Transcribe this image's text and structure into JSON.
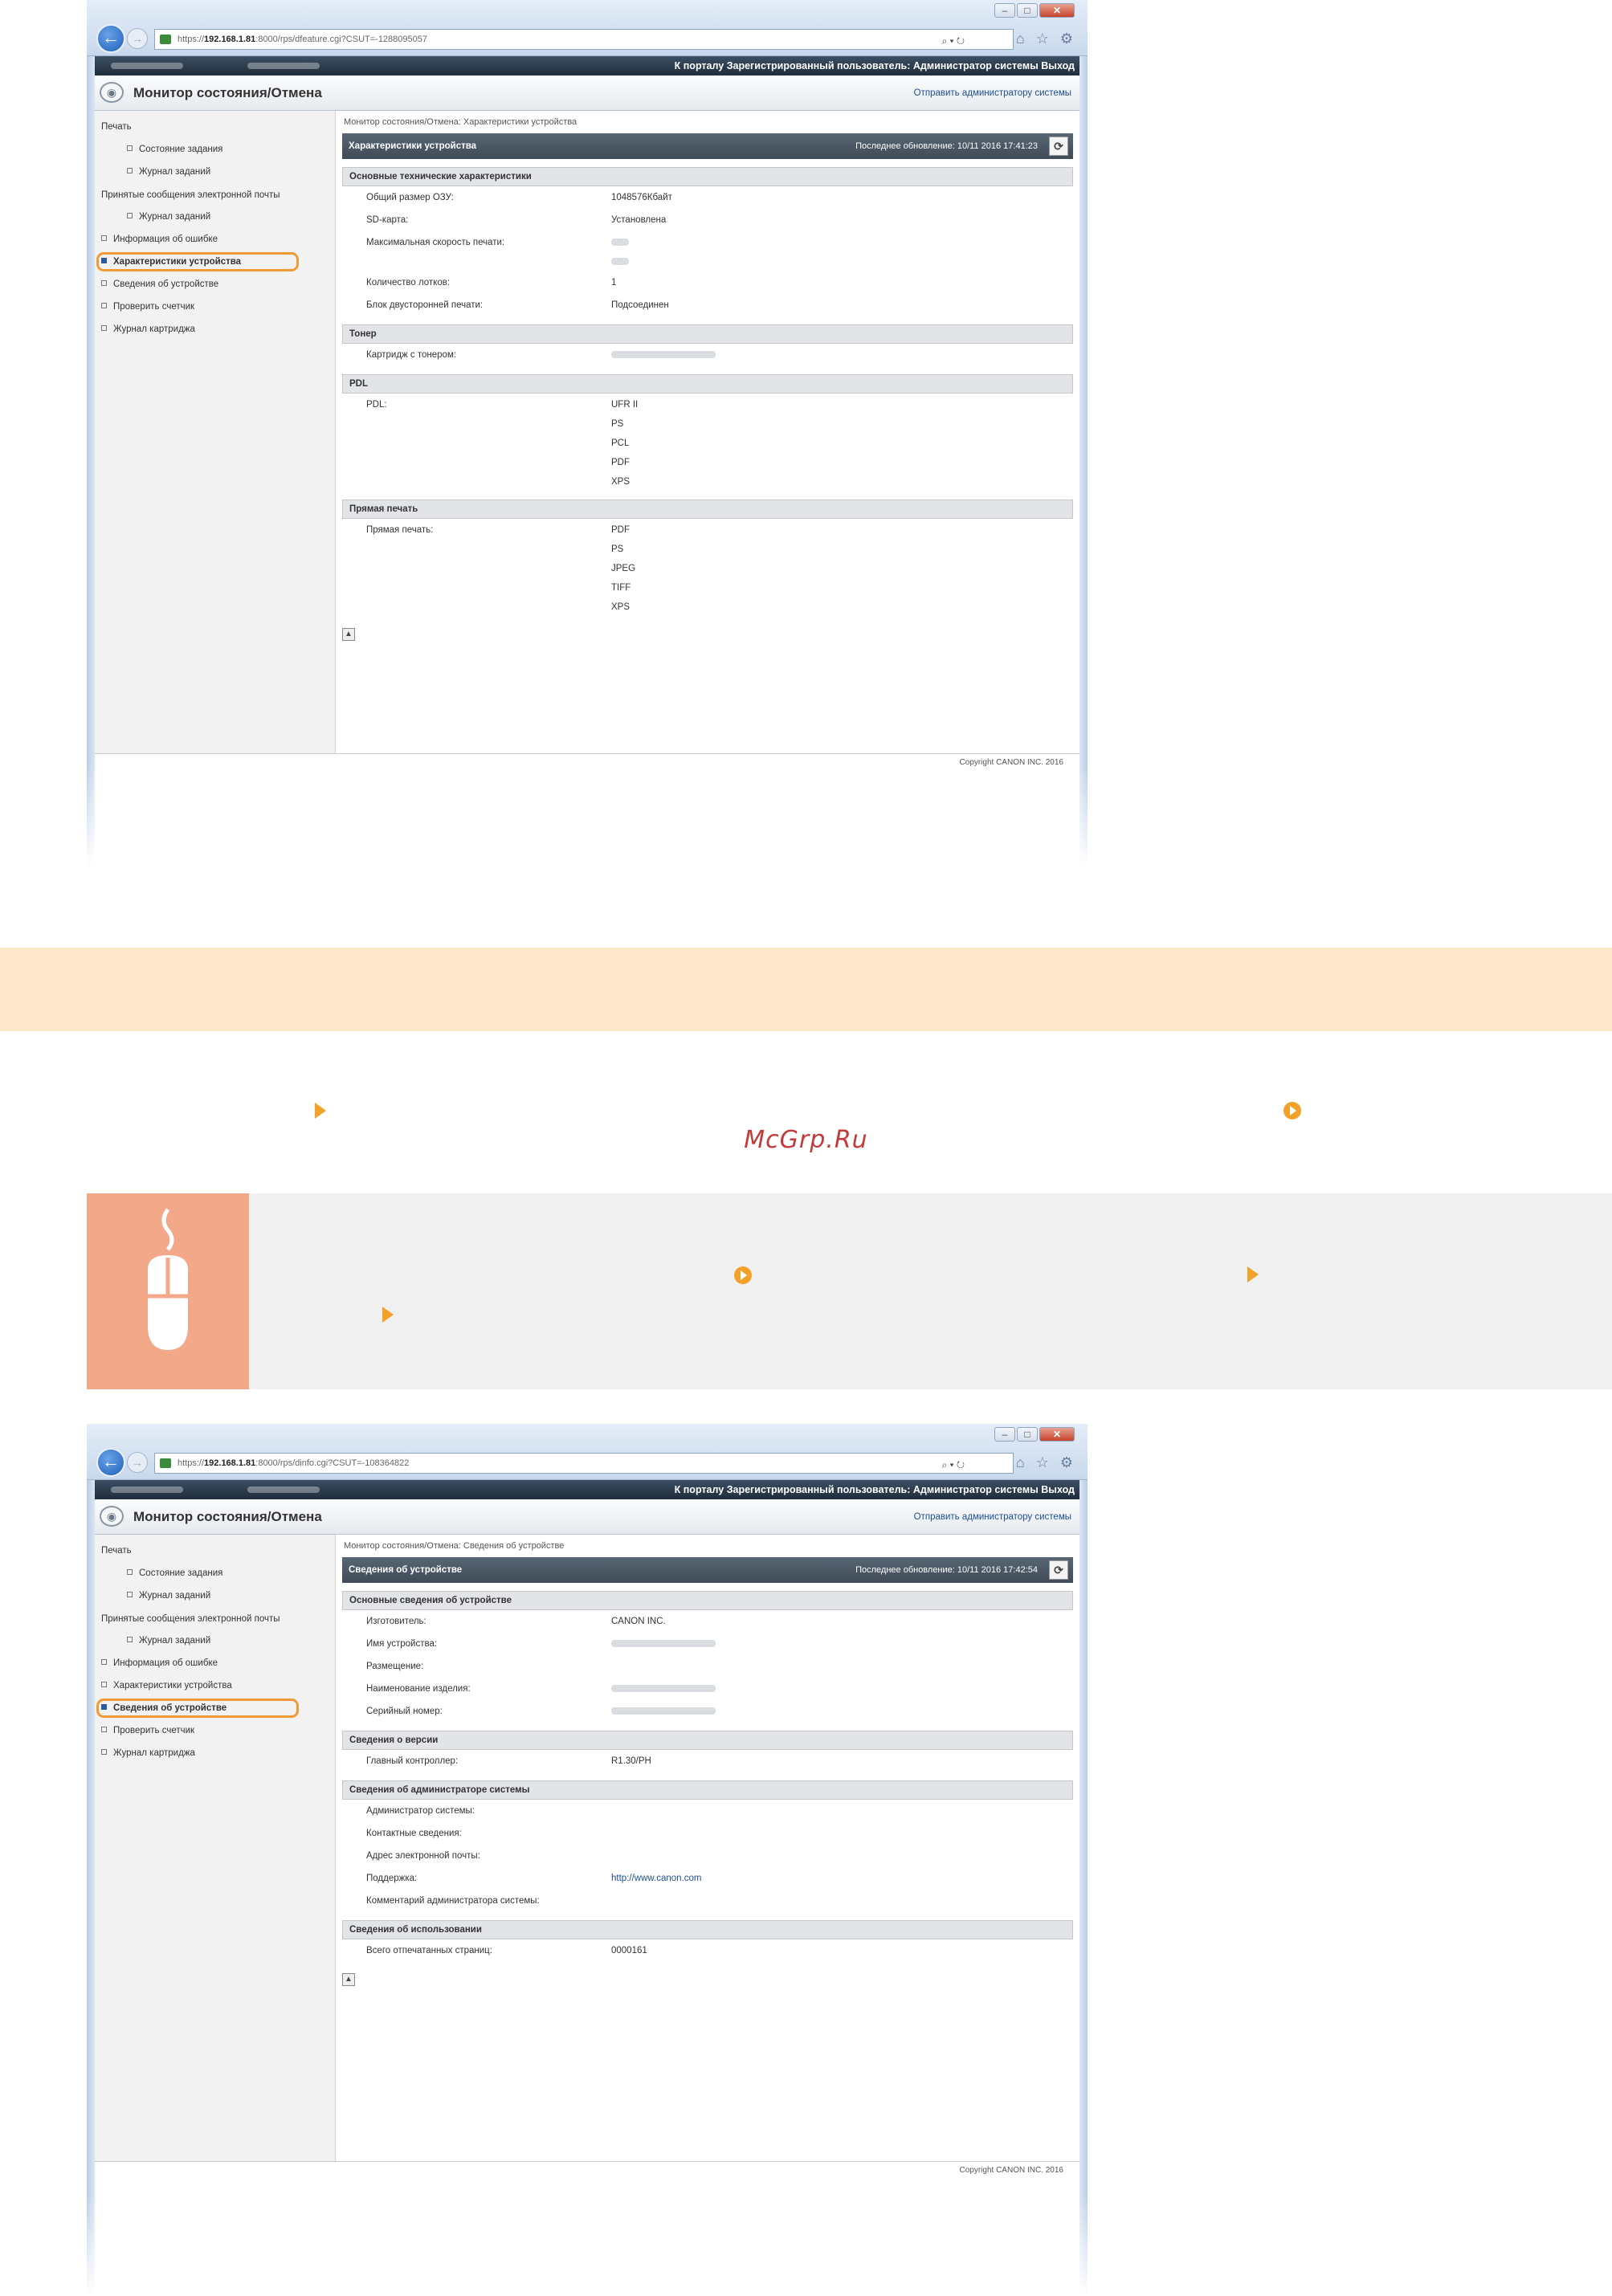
{
  "watermark": "McGrp.Ru",
  "screens": [
    {
      "url_prefix": "https://",
      "url_host": "192.168.1.81",
      "url_path": ":8000/rps/dfeature.cgi?CSUT=-1288095057",
      "addr_tools": "⌕ ▾ ↻",
      "topbar_links": "К порталу   Зарегистрированный пользователь: Администратор системы   Выход",
      "header_title": "Монитор состояния/Отмена",
      "header_link": "Отправить администратору системы",
      "sidebar": [
        {
          "label": "Печать",
          "type": "group"
        },
        {
          "label": "Состояние задания",
          "type": "sub"
        },
        {
          "label": "Журнал заданий",
          "type": "sub"
        },
        {
          "label": "Принятые сообщения электронной почты",
          "type": "group"
        },
        {
          "label": "Журнал заданий",
          "type": "sub"
        },
        {
          "label": "Информация об ошибке",
          "type": "item"
        },
        {
          "label": "Характеристики устройства",
          "type": "item",
          "active": true
        },
        {
          "label": "Сведения об устройстве",
          "type": "item"
        },
        {
          "label": "Проверить счетчик",
          "type": "item"
        },
        {
          "label": "Журнал картриджа",
          "type": "item"
        }
      ],
      "breadcrumb": "Монитор состояния/Отмена: Характеристики устройства",
      "panel_title": "Характеристики устройства",
      "last_update": "Последнее обновление: 10/11 2016 17:41:23",
      "sections": [
        {
          "title": "Основные технические характеристики",
          "rows": [
            {
              "label": "Общий размер ОЗУ:",
              "values": [
                "1048576Кбайт"
              ]
            },
            {
              "label": "SD-карта:",
              "values": [
                "Установлена"
              ]
            },
            {
              "label": "Максимальная скорость печати:",
              "values": [
                "",
                ""
              ]
            },
            {
              "label": "Количество лотков:",
              "values": [
                "1"
              ]
            },
            {
              "label": "Блок двусторонней печати:",
              "values": [
                "Подсоединен"
              ]
            }
          ]
        },
        {
          "title": "Тонер",
          "rows": [
            {
              "label": "Картридж с тонером:",
              "values": [
                ""
              ]
            }
          ]
        },
        {
          "title": "PDL",
          "rows": [
            {
              "label": "PDL:",
              "values": [
                "UFR II",
                "PS",
                "PCL",
                "PDF",
                "XPS"
              ]
            }
          ]
        },
        {
          "title": "Прямая печать",
          "rows": [
            {
              "label": "Прямая печать:",
              "values": [
                "PDF",
                "PS",
                "JPEG",
                "TIFF",
                "XPS"
              ]
            }
          ]
        }
      ],
      "copyright": "Copyright CANON INC. 2016"
    },
    {
      "url_prefix": "https://",
      "url_host": "192.168.1.81",
      "url_path": ":8000/rps/dinfo.cgi?CSUT=-108364822",
      "addr_tools": "⌕ ▾ ↻",
      "topbar_links": "К порталу   Зарегистрированный пользователь: Администратор системы   Выход",
      "header_title": "Монитор состояния/Отмена",
      "header_link": "Отправить администратору системы",
      "sidebar": [
        {
          "label": "Печать",
          "type": "group"
        },
        {
          "label": "Состояние задания",
          "type": "sub"
        },
        {
          "label": "Журнал заданий",
          "type": "sub"
        },
        {
          "label": "Принятые сообщения электронной почты",
          "type": "group"
        },
        {
          "label": "Журнал заданий",
          "type": "sub"
        },
        {
          "label": "Информация об ошибке",
          "type": "item"
        },
        {
          "label": "Характеристики устройства",
          "type": "item"
        },
        {
          "label": "Сведения об устройстве",
          "type": "item",
          "active": true
        },
        {
          "label": "Проверить счетчик",
          "type": "item"
        },
        {
          "label": "Журнал картриджа",
          "type": "item"
        }
      ],
      "breadcrumb": "Монитор состояния/Отмена: Сведения об устройстве",
      "panel_title": "Сведения об устройстве",
      "last_update": "Последнее обновление: 10/11 2016 17:42:54",
      "sections": [
        {
          "title": "Основные сведения об устройстве",
          "rows": [
            {
              "label": "Изготовитель:",
              "values": [
                "CANON INC."
              ]
            },
            {
              "label": "Имя устройства:",
              "values": [
                ""
              ]
            },
            {
              "label": "Размещение:",
              "values": []
            },
            {
              "label": "Наименование изделия:",
              "values": [
                ""
              ]
            },
            {
              "label": "Серийный номер:",
              "values": [
                ""
              ]
            }
          ]
        },
        {
          "title": "Сведения о версии",
          "rows": [
            {
              "label": "Главный контроллер:",
              "values": [
                "R1.30/PH"
              ]
            }
          ]
        },
        {
          "title": "Сведения об администраторе системы",
          "rows": [
            {
              "label": "Администратор системы:",
              "values": []
            },
            {
              "label": "Контактные сведения:",
              "values": []
            },
            {
              "label": "Адрес электронной почты:",
              "values": []
            },
            {
              "label": "Поддержка:",
              "values": [
                "http://www.canon.com"
              ],
              "link": true
            },
            {
              "label": "Комментарий администратора системы:",
              "values": []
            }
          ]
        },
        {
          "title": "Сведения об использовании",
          "rows": [
            {
              "label": "Всего отпечатанных страниц:",
              "values": [
                "0000161"
              ]
            }
          ]
        }
      ],
      "copyright": "Copyright CANON INC. 2016"
    }
  ]
}
